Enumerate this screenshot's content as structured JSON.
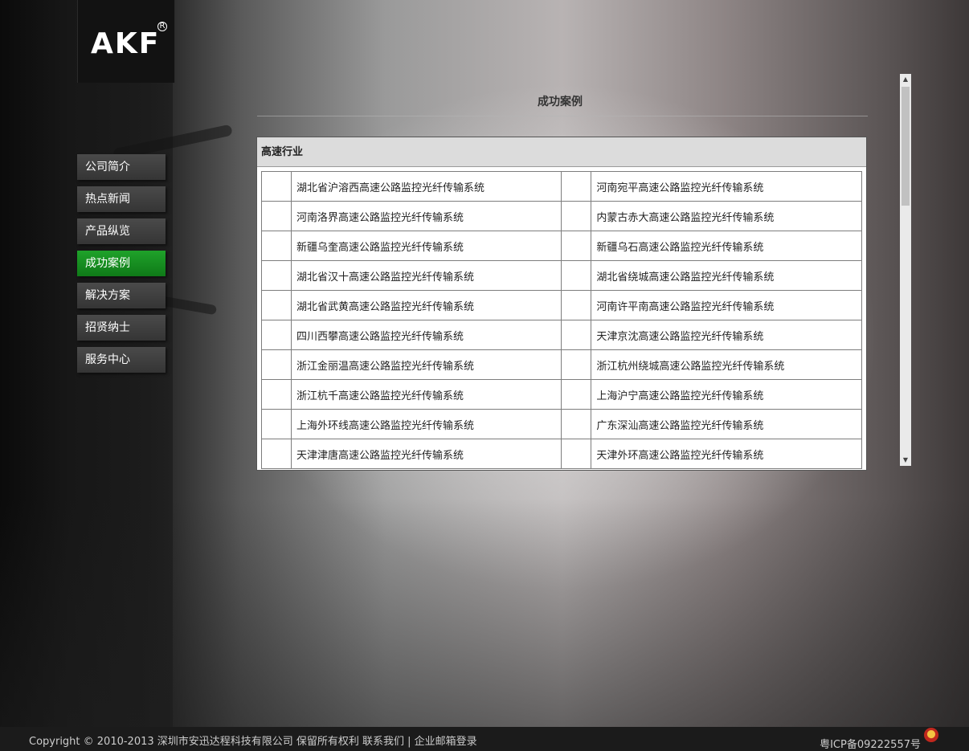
{
  "logo": {
    "text": "AKF",
    "reg": "R"
  },
  "nav": {
    "items": [
      {
        "label": "公司简介",
        "active": false
      },
      {
        "label": "热点新闻",
        "active": false
      },
      {
        "label": "产品纵览",
        "active": false
      },
      {
        "label": "成功案例",
        "active": true
      },
      {
        "label": "解决方案",
        "active": false
      },
      {
        "label": "招贤纳士",
        "active": false
      },
      {
        "label": "服务中心",
        "active": false
      }
    ]
  },
  "page": {
    "title": "成功案例"
  },
  "panel": {
    "header": "高速行业",
    "rows": [
      [
        "湖北省沪溶西高速公路监控光纤传输系统",
        "河南宛平高速公路监控光纤传输系统"
      ],
      [
        "河南洛界高速公路监控光纤传输系统",
        "内蒙古赤大高速公路监控光纤传输系统"
      ],
      [
        "新疆乌奎高速公路监控光纤传输系统",
        "新疆乌石高速公路监控光纤传输系统"
      ],
      [
        "湖北省汉十高速公路监控光纤传输系统",
        "湖北省绕城高速公路监控光纤传输系统"
      ],
      [
        "湖北省武黄高速公路监控光纤传输系统",
        "河南许平南高速公路监控光纤传输系统"
      ],
      [
        "四川西攀高速公路监控光纤传输系统",
        "天津京沈高速公路监控光纤传输系统"
      ],
      [
        "浙江金丽温高速公路监控光纤传输系统",
        "浙江杭州绕城高速公路监控光纤传输系统"
      ],
      [
        "浙江杭千高速公路监控光纤传输系统",
        "上海沪宁高速公路监控光纤传输系统"
      ],
      [
        "上海外环线高速公路监控光纤传输系统",
        "广东深汕高速公路监控光纤传输系统"
      ],
      [
        "天津津唐高速公路监控光纤传输系统",
        "天津外环高速公路监控光纤传输系统"
      ]
    ]
  },
  "footer": {
    "left": "Copyright © 2010-2013 深圳市安迅达程科技有限公司 保留所有权利 联系我们 | 企业邮箱登录",
    "right": "粤ICP备09222557号"
  },
  "colors": {
    "nav_active": "#1a9425",
    "nav_default": "#3f3f3f",
    "footer_bg": "#1b1b1b"
  }
}
